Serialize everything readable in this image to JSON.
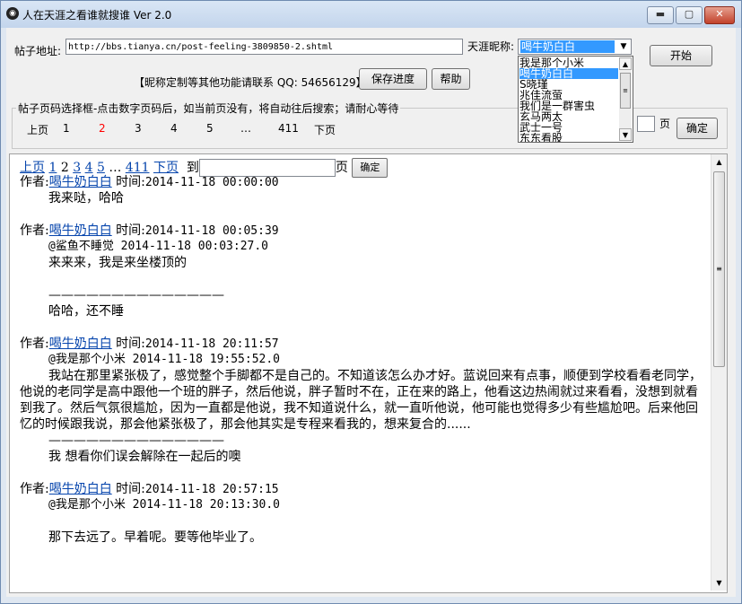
{
  "window": {
    "title": "人在天涯之看谁就搜谁 Ver 2.0",
    "icon_glyph": "◉",
    "min_glyph": "▬",
    "max_glyph": "▢",
    "close_glyph": "✕"
  },
  "toolbar": {
    "url_label": "帖子地址:",
    "url_value": "http://bbs.tianya.cn/post-feeling-3809850-2.shtml",
    "nick_label": "天涯昵称:",
    "nick_value": "喝牛奶白白",
    "start_button": "开始",
    "contact_text": "【昵称定制等其他功能请联系 QQ: 54656129】",
    "save_button": "保存进度",
    "help_button": "帮助"
  },
  "nick_dropdown": {
    "items": [
      "我是那个小米",
      "喝牛奶白白",
      "S晓瑾",
      "兆佳流萤",
      "我们是一群害虫",
      "玄马两太",
      "武士一号",
      "东东看股"
    ],
    "selected_index": 1
  },
  "page_selector": {
    "title": "帖子页码选择框-点击数字页码后，如当前页没有，将自动往后搜索；请耐心等待",
    "prev": "上页",
    "pages": [
      "1",
      "2",
      "3",
      "4",
      "5",
      "…",
      "411"
    ],
    "next": "下页",
    "page_unit": "页",
    "confirm_button": "确定",
    "current_color": "#ff0000"
  },
  "content": {
    "nav": {
      "prev": "上页",
      "pages": [
        "1",
        "2",
        "3",
        "4",
        "5"
      ],
      "current": "2",
      "ellipsis": "…",
      "last": "411",
      "next": "下页",
      "goto": "到",
      "unit": "页",
      "confirm": "确定"
    },
    "author_label": "作者:",
    "time_label": "时间:",
    "posts": [
      {
        "author": "喝牛奶白白",
        "time": "2014-11-18 00:00:00"
      },
      {
        "author": "喝牛奶白白",
        "time": "2014-11-18 00:05:39"
      },
      {
        "author": "喝牛奶白白",
        "time": "2014-11-18 20:11:57"
      },
      {
        "author": "喝牛奶白白",
        "time": "2014-11-18 20:57:15"
      }
    ],
    "p1_body": "我来哒，哈哈",
    "p2_quote": "@鲨鱼不睡觉 2014-11-18 00:03:27.0",
    "p2_quote_body": "来来来，我是来坐楼顶的",
    "divider": "——————————————",
    "p2_body": "哈哈，还不睡",
    "p3_quote": "@我是那个小米 2014-11-18 19:55:52.0",
    "p3_quote_body_first": "我站在那里紧张极了，感觉整个手脚都不是自己的。不知道该怎么办才好。蓝说回来有点事，顺便到学",
    "p3_quote_body_rest": "校看看老同学，他说的老同学是高中跟他一个班的胖子，然后他说，胖子暂时不在，正在来的路上，他看这边热闹就过来看看，没想到就看到我了。然后气氛很尴尬，因为一直都是他说，我不知道说什么，就一直听他说，他可能也觉得多少有些尴尬吧。后来他回忆的时候跟我说，那会他紧张极了，那会他其实是专程来看我的，想来复合的......",
    "p3_body": "我 想看你们误会解除在一起后的噢",
    "p4_quote": "@我是那个小米 2014-11-18 20:13:30.0",
    "p4_body": "那下去远了。早着呢。要等他毕业了。"
  }
}
